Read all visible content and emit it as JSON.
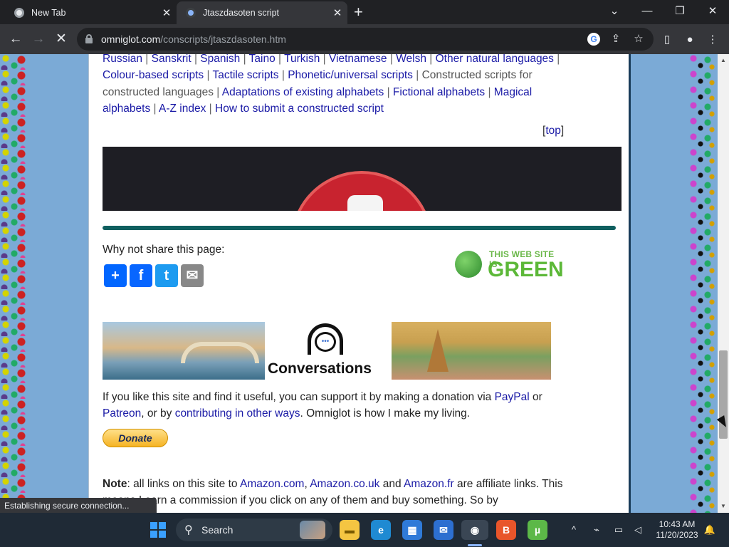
{
  "tabs": [
    {
      "title": "New Tab",
      "active": false
    },
    {
      "title": "Jtaszdasoten script",
      "active": true
    }
  ],
  "new_tab_symbol": "+",
  "window_controls": {
    "minimize": "—",
    "restore": "❐",
    "close": "✕",
    "dropdown": "⌄"
  },
  "address_bar": {
    "domain": "omniglot.com",
    "path": "/conscripts/jtaszdasoten.htm"
  },
  "page": {
    "nav_links": [
      {
        "text": "Russian",
        "link": true
      },
      {
        "text": "Sanskrit",
        "link": true
      },
      {
        "text": "Spanish",
        "link": true
      },
      {
        "text": "Taino",
        "link": true
      },
      {
        "text": "Turkish",
        "link": true
      },
      {
        "text": "Vietnamese",
        "link": true
      },
      {
        "text": "Welsh",
        "link": true
      },
      {
        "text": "Other natural languages",
        "link": true
      },
      {
        "text": "Colour-based scripts",
        "link": true
      },
      {
        "text": "Tactile scripts",
        "link": true
      },
      {
        "text": "Phonetic/universal scripts",
        "link": true
      },
      {
        "text": "Constructed scripts for constructed languages",
        "link": false
      },
      {
        "text": "Adaptations of existing alphabets",
        "link": true
      },
      {
        "text": "Fictional alphabets",
        "link": true
      },
      {
        "text": "Magical alphabets",
        "link": true
      },
      {
        "text": "A-Z index",
        "link": true
      },
      {
        "text": "How to submit a constructed script",
        "link": true
      }
    ],
    "top_link": "top",
    "share_label": "Why not share this page:",
    "share_buttons": [
      {
        "name": "share",
        "symbol": "+",
        "color": "#0166ff"
      },
      {
        "name": "facebook",
        "symbol": "f",
        "color": "#0866ff"
      },
      {
        "name": "twitter",
        "symbol": "t",
        "color": "#1d9bf0"
      },
      {
        "name": "email",
        "symbol": "✉",
        "color": "#888888"
      }
    ],
    "green_badge": {
      "line1": "THIS WEB SITE IS",
      "line2": "GREEN"
    },
    "promo": {
      "title": "Conversations",
      "bubble": "•••"
    },
    "support": {
      "pre": "If you like this site and find it useful, you can support it by making a donation via ",
      "paypal": "PayPal",
      "mid1": " or ",
      "patreon": "Patreon",
      "mid2": ", or by ",
      "contrib": "contributing in other ways",
      "post": ". Omniglot is how I make my living."
    },
    "donate_label": "Donate",
    "note": {
      "bold": "Note",
      "pre": ": all links on this site to ",
      "amazon_com": "Amazon.com",
      "sep1": ", ",
      "amazon_uk": "Amazon.co.uk",
      "sep2": " and ",
      "amazon_fr": "Amazon.fr",
      "post": " are affiliate links. This means I earn a commission if you click on any of them and buy something. So by"
    }
  },
  "status_bubble": "Establishing secure connection...",
  "taskbar": {
    "search_label": "Search",
    "clock_time": "10:43 AM",
    "clock_date": "11/20/2023"
  }
}
